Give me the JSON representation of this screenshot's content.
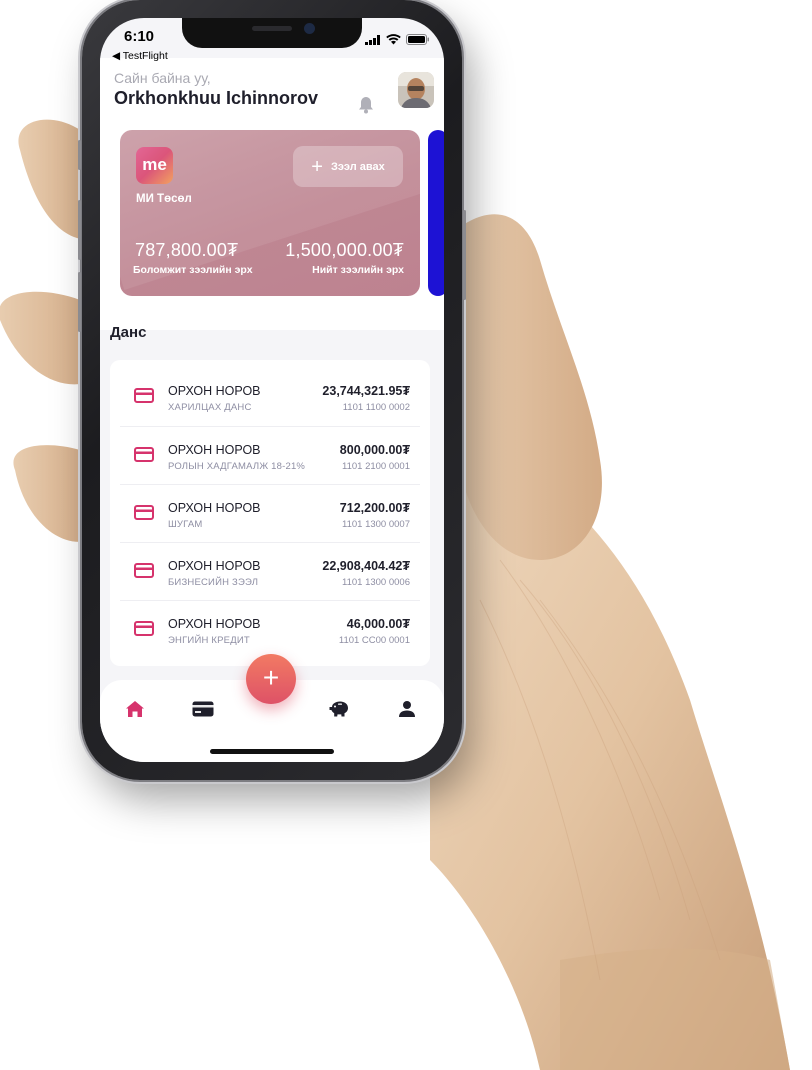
{
  "status": {
    "time": "6:10",
    "back_app": "◀ TestFlight"
  },
  "header": {
    "greeting": "Сайн байна уу,",
    "username": "Orkhonkhuu Ichinnorov"
  },
  "loan_card": {
    "name": "МИ Төсөл",
    "logo_text": "me",
    "apply_label": "Зээл авах",
    "available_amount": "787,800.00₮",
    "available_label": "Боломжит зээлийн эрх",
    "total_amount": "1,500,000.00₮",
    "total_label": "Нийт зээлийн эрх"
  },
  "accounts_section": {
    "title": "Данс",
    "items": [
      {
        "name": "ОРХОН НОРОВ",
        "type": "ХАРИЛЦАХ ДАНС",
        "balance": "23,744,321.95₮",
        "number": "1101 1100 0002"
      },
      {
        "name": "ОРХОН НОРОВ",
        "type": "РОЛЫН ХАДГАМАЛЖ 18-21%",
        "balance": "800,000.00₮",
        "number": "1101 2100 0001"
      },
      {
        "name": "ОРХОН НОРОВ",
        "type": "ШУГАМ",
        "balance": "712,200.00₮",
        "number": "1101 1300 0007"
      },
      {
        "name": "ОРХОН НОРОВ",
        "type": "БИЗНЕСИЙН ЗЭЭЛ",
        "balance": "22,908,404.42₮",
        "number": "1101 1300 0006"
      },
      {
        "name": "ОРХОН НОРОВ",
        "type": "ЭНГИЙН КРЕДИТ",
        "balance": "46,000.00₮",
        "number": "1101 СС00 0001"
      }
    ]
  },
  "tabbar": {
    "fab_label": "+",
    "tabs": [
      "home-icon",
      "card-icon",
      "piggy-bank-icon",
      "profile-icon"
    ]
  },
  "colors": {
    "accent": "#d6336c",
    "card": "#c38b97",
    "fab": "#e5605f",
    "peek_card": "#1d12d4"
  }
}
